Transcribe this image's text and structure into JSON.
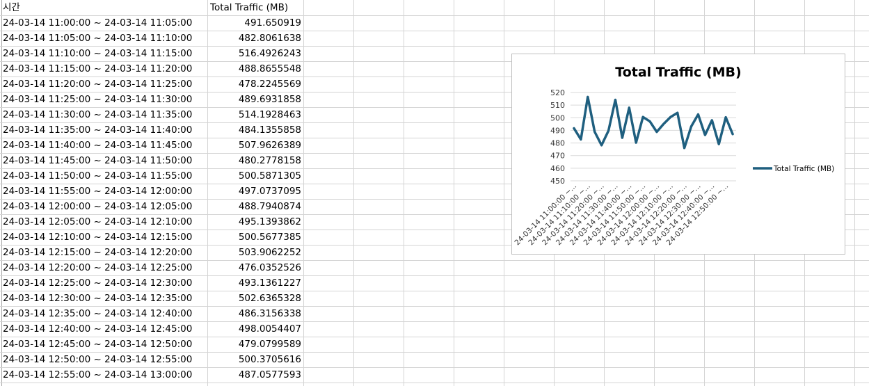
{
  "sheet": {
    "headers": [
      "시간",
      "Total Traffic (MB)"
    ],
    "rows": [
      [
        "24-03-14 11:00:00 ~ 24-03-14 11:05:00",
        "491.650919"
      ],
      [
        "24-03-14 11:05:00 ~ 24-03-14 11:10:00",
        "482.8061638"
      ],
      [
        "24-03-14 11:10:00 ~ 24-03-14 11:15:00",
        "516.4926243"
      ],
      [
        "24-03-14 11:15:00 ~ 24-03-14 11:20:00",
        "488.8655548"
      ],
      [
        "24-03-14 11:20:00 ~ 24-03-14 11:25:00",
        "478.2245569"
      ],
      [
        "24-03-14 11:25:00 ~ 24-03-14 11:30:00",
        "489.6931858"
      ],
      [
        "24-03-14 11:30:00 ~ 24-03-14 11:35:00",
        "514.1928463"
      ],
      [
        "24-03-14 11:35:00 ~ 24-03-14 11:40:00",
        "484.1355858"
      ],
      [
        "24-03-14 11:40:00 ~ 24-03-14 11:45:00",
        "507.9626389"
      ],
      [
        "24-03-14 11:45:00 ~ 24-03-14 11:50:00",
        "480.2778158"
      ],
      [
        "24-03-14 11:50:00 ~ 24-03-14 11:55:00",
        "500.5871305"
      ],
      [
        "24-03-14 11:55:00 ~ 24-03-14 12:00:00",
        "497.0737095"
      ],
      [
        "24-03-14 12:00:00 ~ 24-03-14 12:05:00",
        "488.7940874"
      ],
      [
        "24-03-14 12:05:00 ~ 24-03-14 12:10:00",
        "495.1393862"
      ],
      [
        "24-03-14 12:10:00 ~ 24-03-14 12:15:00",
        "500.5677385"
      ],
      [
        "24-03-14 12:15:00 ~ 24-03-14 12:20:00",
        "503.9062252"
      ],
      [
        "24-03-14 12:20:00 ~ 24-03-14 12:25:00",
        "476.0352526"
      ],
      [
        "24-03-14 12:25:00 ~ 24-03-14 12:30:00",
        "493.1361227"
      ],
      [
        "24-03-14 12:30:00 ~ 24-03-14 12:35:00",
        "502.6365328"
      ],
      [
        "24-03-14 12:35:00 ~ 24-03-14 12:40:00",
        "486.3156338"
      ],
      [
        "24-03-14 12:40:00 ~ 24-03-14 12:45:00",
        "498.0054407"
      ],
      [
        "24-03-14 12:45:00 ~ 24-03-14 12:50:00",
        "479.0799589"
      ],
      [
        "24-03-14 12:50:00 ~ 24-03-14 12:55:00",
        "500.3705616"
      ],
      [
        "24-03-14 12:55:00 ~ 24-03-14 13:00:00",
        "487.0577593"
      ]
    ]
  },
  "chart_data": {
    "type": "line",
    "title": "Total Traffic (MB)",
    "xlabel": "",
    "ylabel": "",
    "categories": [
      "24-03-14 11:00:00 ~...",
      "24-03-14 11:05:00 ~...",
      "24-03-14 11:10:00 ~...",
      "24-03-14 11:15:00 ~...",
      "24-03-14 11:20:00 ~...",
      "24-03-14 11:25:00 ~...",
      "24-03-14 11:30:00 ~...",
      "24-03-14 11:35:00 ~...",
      "24-03-14 11:40:00 ~...",
      "24-03-14 11:45:00 ~...",
      "24-03-14 11:50:00 ~...",
      "24-03-14 11:55:00 ~...",
      "24-03-14 12:00:00 ~...",
      "24-03-14 12:05:00 ~...",
      "24-03-14 12:10:00 ~...",
      "24-03-14 12:15:00 ~...",
      "24-03-14 12:20:00 ~...",
      "24-03-14 12:25:00 ~...",
      "24-03-14 12:30:00 ~...",
      "24-03-14 12:35:00 ~...",
      "24-03-14 12:40:00 ~...",
      "24-03-14 12:45:00 ~...",
      "24-03-14 12:50:00 ~...",
      "24-03-14 12:55:00 ~..."
    ],
    "x_tick_labels": [
      "24-03-14 11:00:00 ~...",
      "24-03-14 11:10:00 ~...",
      "24-03-14 11:20:00 ~...",
      "24-03-14 11:30:00 ~...",
      "24-03-14 11:40:00 ~...",
      "24-03-14 11:50:00 ~...",
      "24-03-14 12:00:00 ~...",
      "24-03-14 12:10:00 ~...",
      "24-03-14 12:20:00 ~...",
      "24-03-14 12:30:00 ~...",
      "24-03-14 12:40:00 ~...",
      "24-03-14 12:50:00 ~..."
    ],
    "series": [
      {
        "name": "Total Traffic (MB)",
        "color": "#1f5f7f",
        "values": [
          491.650919,
          482.8061638,
          516.4926243,
          488.8655548,
          478.2245569,
          489.6931858,
          514.1928463,
          484.1355858,
          507.9626389,
          480.2778158,
          500.5871305,
          497.0737095,
          488.7940874,
          495.1393862,
          500.5677385,
          503.9062252,
          476.0352526,
          493.1361227,
          502.6365328,
          486.3156338,
          498.0054407,
          479.0799589,
          500.3705616,
          487.0577593
        ]
      }
    ],
    "ylim": [
      450,
      520
    ],
    "yticks": [
      450,
      460,
      470,
      480,
      490,
      500,
      510,
      520
    ],
    "grid": true,
    "legend": "right"
  },
  "colors": {
    "gridline": "#d4d4d4",
    "chart_line": "#1f5f7f",
    "chart_gridline": "#d9d9d9"
  }
}
